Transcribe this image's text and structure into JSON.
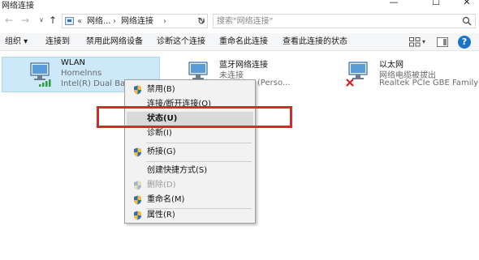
{
  "window": {
    "title": "网络连接",
    "min_glyph": "—",
    "max_glyph": "☐",
    "close_glyph": "✕"
  },
  "nav": {
    "back_glyph": "←",
    "forward_glyph": "→",
    "history_glyph": "∨",
    "up_glyph": "↑",
    "breadcrumb_overflow": "«",
    "breadcrumb_1": "网络...",
    "breadcrumb_sep": "›",
    "breadcrumb_2": "网络连接",
    "breadcrumb_sep2": "›",
    "address_dropdown_glyph": "∨",
    "refresh_glyph": "↻",
    "search_placeholder": "搜索\"网络连接\""
  },
  "toolbar": {
    "organize": "组织 ▾",
    "connect_to": "连接到",
    "disable_device": "禁用此网络设备",
    "diagnose": "诊断这个连接",
    "rename": "重命名此连接",
    "view_status": "查看此连接的状态",
    "view_dropdown_glyph": "▾",
    "help_glyph": "?"
  },
  "adapters": [
    {
      "name": "WLAN",
      "status": "Homelnns",
      "device": "Intel(R) Dual Band"
    },
    {
      "name": "蓝牙网络连接",
      "status": "未连接",
      "device": "n Device (Perso..."
    },
    {
      "name": "以太网",
      "status": "网络电缆被拔出",
      "device": "Realtek PCIe GBE Family ..."
    }
  ],
  "context_menu": {
    "items": [
      {
        "label": "禁用(B)",
        "shield": true
      },
      {
        "label": "连接/断开连接(O)",
        "shield": false
      },
      {
        "label": "状态(U)",
        "shield": false,
        "bold": true,
        "highlighted": true
      },
      {
        "label": "诊断(I)",
        "shield": false
      },
      {
        "label": "桥接(G)",
        "shield": true
      },
      {
        "label": "创建快捷方式(S)",
        "shield": false
      },
      {
        "label": "删除(D)",
        "shield": true,
        "disabled": true
      },
      {
        "label": "重命名(M)",
        "shield": true
      },
      {
        "label": "属性(R)",
        "shield": true
      }
    ]
  },
  "colors": {
    "selection_bg": "#cde8f8",
    "highlight_box": "#d62a2a",
    "help_blue": "#1a73c9"
  }
}
